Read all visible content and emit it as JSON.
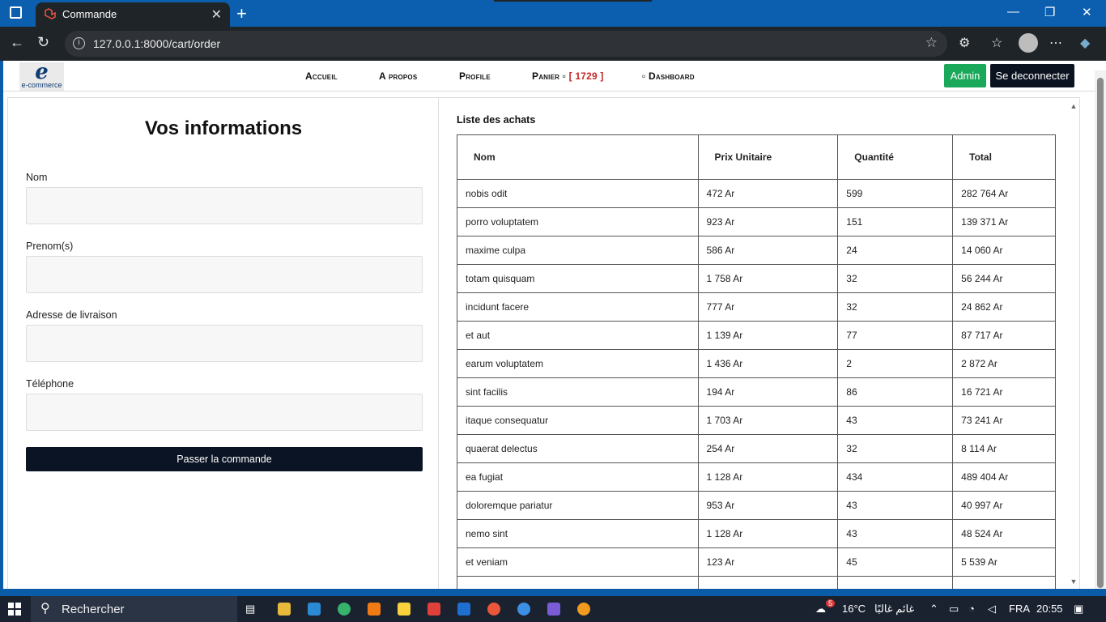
{
  "browser": {
    "tab_title": "Commande",
    "url": "127.0.0.1:8000/cart/order"
  },
  "navbar": {
    "logo_text": "e-commerce",
    "logo_letter": "e",
    "items": [
      {
        "label": "Accueil"
      },
      {
        "label": "A propos"
      },
      {
        "label": "Profile"
      },
      {
        "label": "Panier ▫",
        "badge": "[ 1729 ]"
      },
      {
        "label": "▫ Dashboard"
      }
    ],
    "admin_label": "Admin",
    "logout_label": "Se deconnecter"
  },
  "form": {
    "title": "Vos informations",
    "fields": [
      {
        "label": "Nom",
        "value": ""
      },
      {
        "label": "Prenom(s)",
        "value": ""
      },
      {
        "label": "Adresse de livraison",
        "value": ""
      },
      {
        "label": "Téléphone",
        "value": ""
      }
    ],
    "submit_label": "Passer la commande"
  },
  "orders": {
    "title": "Liste des achats",
    "columns": [
      "Nom",
      "Prix Unitaire",
      "Quantité",
      "Total"
    ],
    "rows": [
      [
        "nobis odit",
        "472 Ar",
        "599",
        "282 764 Ar"
      ],
      [
        "porro voluptatem",
        "923 Ar",
        "151",
        "139 371 Ar"
      ],
      [
        "maxime culpa",
        "586 Ar",
        "24",
        "14 060 Ar"
      ],
      [
        "totam quisquam",
        "1 758 Ar",
        "32",
        "56 244 Ar"
      ],
      [
        "incidunt facere",
        "777 Ar",
        "32",
        "24 862 Ar"
      ],
      [
        "et aut",
        "1 139 Ar",
        "77",
        "87 717 Ar"
      ],
      [
        "earum voluptatem",
        "1 436 Ar",
        "2",
        "2 872 Ar"
      ],
      [
        "sint facilis",
        "194 Ar",
        "86",
        "16 721 Ar"
      ],
      [
        "itaque consequatur",
        "1 703 Ar",
        "43",
        "73 241 Ar"
      ],
      [
        "quaerat delectus",
        "254 Ar",
        "32",
        "8 114 Ar"
      ],
      [
        "ea fugiat",
        "1 128 Ar",
        "434",
        "489 404 Ar"
      ],
      [
        "doloremque pariatur",
        "953 Ar",
        "43",
        "40 997 Ar"
      ],
      [
        "nemo sint",
        "1 128 Ar",
        "43",
        "48 524 Ar"
      ],
      [
        "et veniam",
        "123 Ar",
        "45",
        "5 539 Ar"
      ],
      [
        "",
        "",
        "",
        ""
      ]
    ]
  },
  "taskbar": {
    "search_placeholder": "Rechercher",
    "weather": "16°C",
    "weather_desc": "غائم غالبًا",
    "notification_count": "5",
    "language": "FRA",
    "time": "20:55"
  }
}
